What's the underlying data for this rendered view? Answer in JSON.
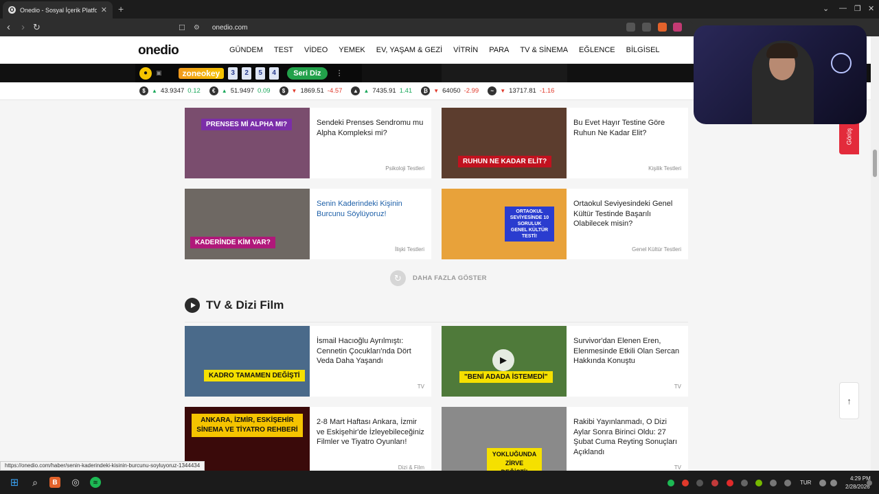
{
  "browser": {
    "tab_title": "Onedio - Sosyal İçerik Platformu",
    "tab_favicon": "O",
    "url": "onedio.com"
  },
  "site": {
    "logo": "onedio",
    "nav": [
      "GÜNDEM",
      "TEST",
      "VİDEO",
      "YEMEK",
      "EV, YAŞAM & GEZİ",
      "VİTRİN",
      "PARA",
      "TV & SİNEMA",
      "EĞLENCE",
      "BİLGİSEL"
    ]
  },
  "ad": {
    "brand": "zoneokey",
    "tiles": [
      "3",
      "2",
      "5",
      "4"
    ],
    "cta": "Seri Diz"
  },
  "ticker": [
    {
      "symbol": "$",
      "direction": "up",
      "value": "43.9347",
      "change": "0.12"
    },
    {
      "symbol": "€",
      "direction": "up",
      "value": "51.9497",
      "change": "0.09"
    },
    {
      "symbol": "$",
      "direction": "down",
      "value": "1869.51",
      "change": "-4.57"
    },
    {
      "symbol": "▲",
      "direction": "up",
      "value": "7435.91",
      "change": "1.41"
    },
    {
      "symbol": "₿",
      "direction": "down",
      "value": "64050",
      "change": "-2.99"
    },
    {
      "symbol": "~",
      "direction": "down",
      "value": "13717.81",
      "change": "-1.16"
    }
  ],
  "tests": [
    {
      "title": "Sendeki Prenses Sendromu mu Alpha Kompleksi mi?",
      "category": "Psikoloji Testleri",
      "caption": "PRENSES Mİ ALPHA MI?",
      "caption_color": "#7b2ea8",
      "thumb_bg": "#7a4d6e"
    },
    {
      "title": "Bu Evet Hayır Testine Göre Ruhun Ne Kadar Elit?",
      "category": "Kişilik Testleri",
      "caption": "RUHUN NE KADAR ELİT?",
      "caption_color": "#c1121f",
      "thumb_bg": "#5c3d2e"
    },
    {
      "title": "Senin Kaderindeki Kişinin Burcunu Söylüyoruz!",
      "category": "İlişki Testleri",
      "caption": "KADERİNDE KİM VAR?",
      "caption_color": "#b0187a",
      "thumb_bg": "#6e6863"
    },
    {
      "title": "Ortaokul Seviyesindeki Genel Kültür Testinde Başarılı Olabilecek misin?",
      "category": "Genel Kültür Testleri",
      "caption": "ORTAOKUL SEVİYESİNDE 10 SORULUK GENEL KÜLTÜR TESTİ!",
      "caption_color": "#2a3ccf",
      "thumb_bg": "#e8a23a"
    }
  ],
  "more_label": "DAHA FAZLA GÖSTER",
  "section_title": "TV & Dizi Film",
  "tv": [
    {
      "title": "İsmail Hacıoğlu Ayrılmıştı: Cennetin Çocukları'nda Dört Veda Daha Yaşandı",
      "category": "TV",
      "caption": "KADRO TAMAMEN DEĞİŞTİ",
      "caption_color": "#f5e000",
      "thumb_bg": "#4a6a8a"
    },
    {
      "title": "Survivor'dan Elenen Eren, Elenmesinde Etkili Olan Sercan Hakkında Konuştu",
      "category": "TV",
      "caption": "\"BENİ ADADA İSTEMEDİ\"",
      "caption_color": "#f5e000",
      "thumb_bg": "#4f7a3a"
    },
    {
      "title": "2-8 Mart Haftası Ankara, İzmir ve Eskişehir'de İzleyebileceğiniz Filmler ve Tiyatro Oyunları!",
      "category": "Dizi & Film",
      "caption": "ANKARA, İZMİR, ESKİŞEHİR SİNEMA VE TİYATRO REHBERİ",
      "caption_color": "#f5c400",
      "thumb_bg": "#3a0a0a"
    },
    {
      "title": "Rakibi Yayınlanmadı, O Dizi Aylar Sonra Birinci Oldu: 27 Şubat Cuma Reyting Sonuçları Açıklandı",
      "category": "TV",
      "caption": "YOKLUĞUNDA ZİRVE DEĞİŞTİ!",
      "caption_color": "#f5e000",
      "thumb_bg": "#8a8a8a"
    }
  ],
  "status_url": "https://onedio.com/haber/senin-kaderindeki-kisinin-burcunu-soyluyoruz-1344434",
  "feedback_label": "Görüş",
  "system": {
    "lang": "TUR",
    "time": "4:29 PM",
    "date": "2/28/2026"
  }
}
